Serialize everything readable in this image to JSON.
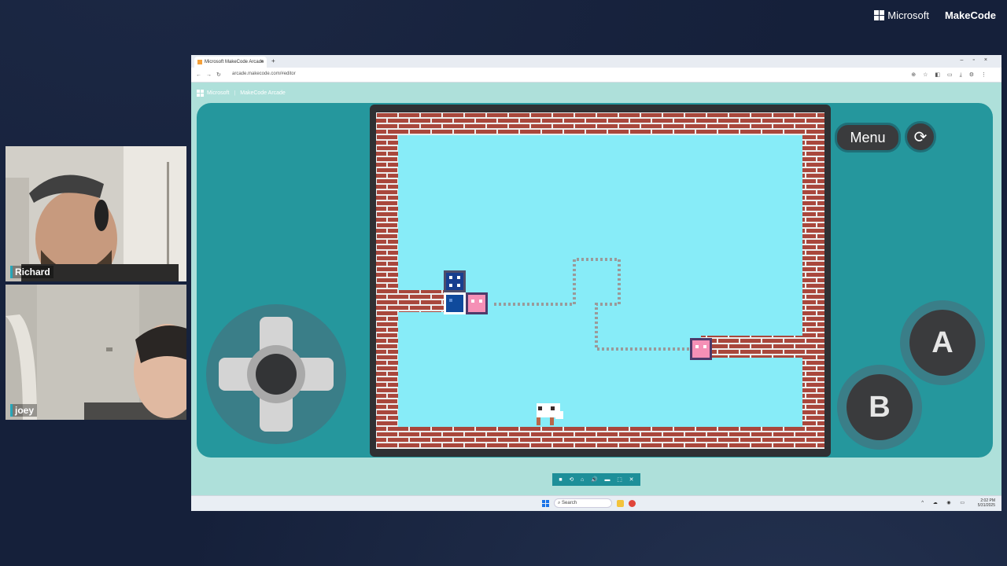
{
  "brand": {
    "microsoft": "Microsoft",
    "makecode": "MakeCode"
  },
  "participants": [
    {
      "name": "Richard"
    },
    {
      "name": "joey"
    }
  ],
  "browser": {
    "tab_title": "Microsoft MakeCode Arcade",
    "tab_close": "×",
    "new_tab": "+",
    "window_controls": "–▫×",
    "nav": "←→↻",
    "url": "arcade.makecode.com/#editor",
    "tools": "⊕☆◧▭⤓⚙⋮"
  },
  "makecode_header": {
    "microsoft": "Microsoft",
    "sep": "|",
    "product": "MakeCode Arcade"
  },
  "simulator": {
    "menu_label": "Menu",
    "reset_icon": "⟳",
    "button_a": "A",
    "button_b": "B",
    "toolbar_icons": [
      "■",
      "⟲",
      "⌂",
      "🔊",
      "▬",
      "⬚",
      "✕"
    ]
  },
  "taskbar": {
    "search_placeholder": "Search",
    "time": "2:02 PM",
    "date": "5/31/2025",
    "tray": "^ ☁ ◉ ▭"
  },
  "colors": {
    "sky": "#87ecf8",
    "brick": "#a9473c",
    "mortar": "#ededed",
    "console": "#25979d",
    "frame": "#2f3033",
    "pink": "#f590b6",
    "blue": "#183f8f"
  }
}
